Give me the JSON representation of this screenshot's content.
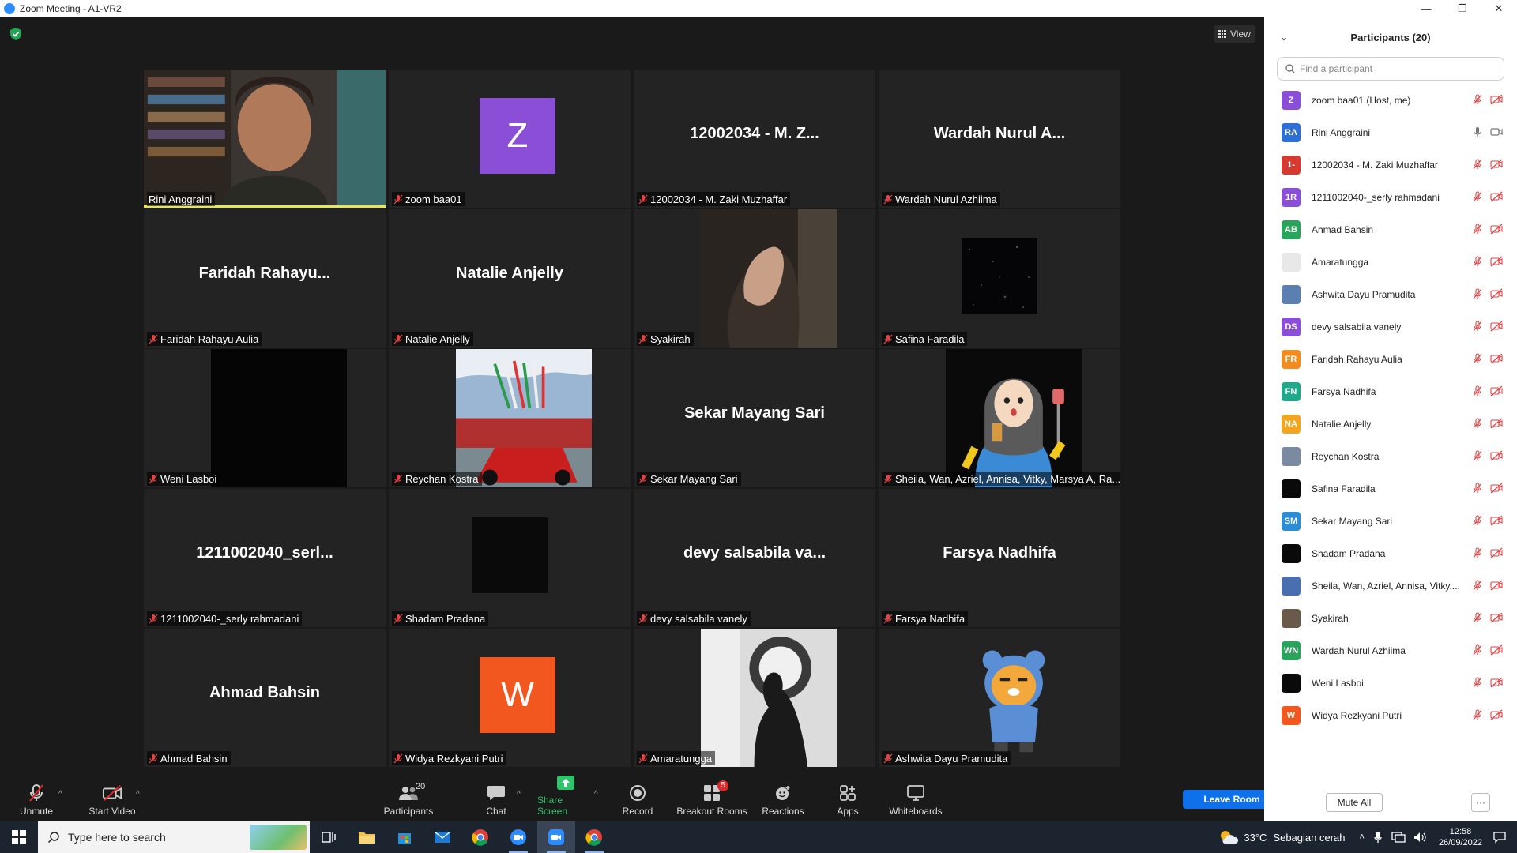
{
  "window": {
    "title": "Zoom Meeting - A1-VR2",
    "minimize": "—",
    "maximize": "❐",
    "close": "✕"
  },
  "view_label": "View",
  "tiles": [
    {
      "label": "Rini Anggraini",
      "kind": "video",
      "muted": false,
      "active": true
    },
    {
      "label": "zoom baa01",
      "kind": "avatar",
      "initial": "Z",
      "color": "#8a4fd6",
      "muted": true
    },
    {
      "label": "12002034 - M. Zaki Muzhaffar",
      "kind": "name",
      "big": "12002034 - M. Z...",
      "muted": true
    },
    {
      "label": "Wardah Nurul Azhiima",
      "kind": "name",
      "big": "Wardah Nurul A...",
      "muted": true
    },
    {
      "label": "Faridah Rahayu Aulia",
      "kind": "name",
      "big": "Faridah  Rahayu...",
      "muted": true
    },
    {
      "label": "Natalie Anjelly",
      "kind": "name",
      "big": "Natalie Anjelly",
      "muted": true
    },
    {
      "label": "Syakirah",
      "kind": "photo-hand",
      "muted": true
    },
    {
      "label": "Safina Faradila",
      "kind": "stars",
      "muted": true
    },
    {
      "label": "Weni Lasboi",
      "kind": "black",
      "muted": true
    },
    {
      "label": "Reychan Kostra",
      "kind": "photo-f1",
      "muted": true
    },
    {
      "label": "Sekar Mayang Sari",
      "kind": "name",
      "big": "Sekar Mayang Sari",
      "muted": true
    },
    {
      "label": "Sheila, Wan, Azriel, Annisa, Vitky, Marsya A, Ra...",
      "kind": "photo-cartoon",
      "muted": true
    },
    {
      "label": "1211002040-_serly rahmadani",
      "kind": "name",
      "big": "1211002040_serl...",
      "muted": true
    },
    {
      "label": "Shadam Pradana",
      "kind": "dark",
      "muted": true
    },
    {
      "label": "devy salsabila vanely",
      "kind": "name",
      "big": "devy salsabila va...",
      "muted": true
    },
    {
      "label": "Farsya Nadhifa",
      "kind": "name",
      "big": "Farsya Nadhifa",
      "muted": true
    },
    {
      "label": "Ahmad Bahsin",
      "kind": "name",
      "big": "Ahmad Bahsin",
      "muted": true
    },
    {
      "label": "Widya Rezkyani Putri",
      "kind": "avatar",
      "initial": "W",
      "color": "#f2571f",
      "muted": true
    },
    {
      "label": "Amaratungga",
      "kind": "photo-silhouette",
      "muted": true
    },
    {
      "label": "Ashwita Dayu Pramudita",
      "kind": "photo-bear",
      "muted": true
    }
  ],
  "toolbar": {
    "unmute": "Unmute",
    "start_video": "Start Video",
    "participants": "Participants",
    "participants_count": "20",
    "chat": "Chat",
    "share_screen": "Share Screen",
    "record": "Record",
    "breakout_rooms": "Breakout Rooms",
    "breakout_badge": "5",
    "reactions": "Reactions",
    "apps": "Apps",
    "whiteboards": "Whiteboards",
    "leave_room": "Leave Room"
  },
  "panel": {
    "title": "Participants (20)",
    "search_placeholder": "Find a participant",
    "mute_all": "Mute All",
    "more": "···",
    "participants": [
      {
        "initials": "Z",
        "color": "#8a4fd6",
        "name": "zoom baa01 (Host, me)",
        "mic": "off",
        "video": "off"
      },
      {
        "initials": "RA",
        "color": "#2d6fd6",
        "name": "Rini Anggraini",
        "mic": "on",
        "video": "on"
      },
      {
        "initials": "1-",
        "color": "#d63a2f",
        "name": "12002034 - M. Zaki Muzhaffar",
        "mic": "off",
        "video": "off"
      },
      {
        "initials": "1R",
        "color": "#8a4fd6",
        "name": "1211002040-_serly rahmadani",
        "mic": "off",
        "video": "off"
      },
      {
        "initials": "AB",
        "color": "#28a55a",
        "name": "Ahmad Bahsin",
        "mic": "off",
        "video": "off"
      },
      {
        "initials": "",
        "color": "#e8e8e8",
        "name": "Amaratungga",
        "mic": "off",
        "video": "off",
        "photo": "silhouette"
      },
      {
        "initials": "",
        "color": "#5a7fb0",
        "name": "Ashwita Dayu Pramudita",
        "mic": "off",
        "video": "off",
        "photo": "bear"
      },
      {
        "initials": "DS",
        "color": "#8a4fd6",
        "name": "devy salsabila vanely",
        "mic": "off",
        "video": "off"
      },
      {
        "initials": "FR",
        "color": "#f28c1f",
        "name": "Faridah Rahayu Aulia",
        "mic": "off",
        "video": "off"
      },
      {
        "initials": "FN",
        "color": "#1fa88a",
        "name": "Farsya Nadhifa",
        "mic": "off",
        "video": "off"
      },
      {
        "initials": "NA",
        "color": "#f2a51f",
        "name": "Natalie Anjelly",
        "mic": "off",
        "video": "off"
      },
      {
        "initials": "",
        "color": "#7a8aa0",
        "name": "Reychan Kostra",
        "mic": "off",
        "video": "off",
        "photo": "f1"
      },
      {
        "initials": "",
        "color": "#0a0a0a",
        "name": "Safina Faradila",
        "mic": "off",
        "video": "off"
      },
      {
        "initials": "SM",
        "color": "#2d8cd6",
        "name": "Sekar Mayang Sari",
        "mic": "off",
        "video": "off"
      },
      {
        "initials": "",
        "color": "#0a0a0a",
        "name": "Shadam Pradana",
        "mic": "off",
        "video": "off"
      },
      {
        "initials": "",
        "color": "#4a6fb0",
        "name": "Sheila, Wan, Azriel, Annisa, Vitky,...",
        "mic": "off",
        "video": "off",
        "photo": "cartoon"
      },
      {
        "initials": "",
        "color": "#6a5a4a",
        "name": "Syakirah",
        "mic": "off",
        "video": "off",
        "photo": "hand"
      },
      {
        "initials": "WN",
        "color": "#28a55a",
        "name": "Wardah Nurul Azhiima",
        "mic": "off",
        "video": "off"
      },
      {
        "initials": "",
        "color": "#0a0a0a",
        "name": "Weni Lasboi",
        "mic": "off",
        "video": "off"
      },
      {
        "initials": "W",
        "color": "#f2571f",
        "name": "Widya Rezkyani Putri",
        "mic": "off",
        "video": "off"
      }
    ]
  },
  "taskbar": {
    "search_placeholder": "Type here to search",
    "weather_temp": "33°C",
    "weather_desc": "Sebagian cerah",
    "time": "12:58",
    "date": "26/09/2022"
  }
}
